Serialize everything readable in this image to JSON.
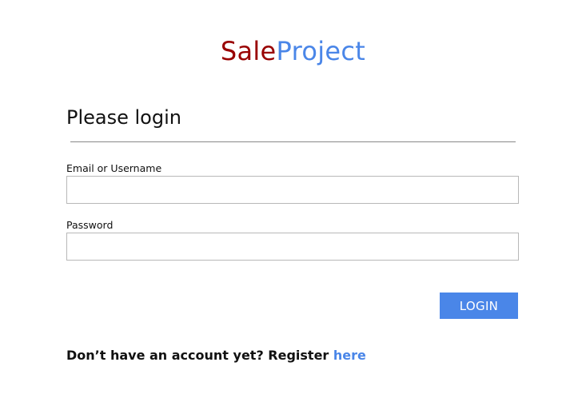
{
  "brand": {
    "part1": "Sale",
    "part2": "Project",
    "part1_color": "#990000",
    "part2_color": "#4a86e8"
  },
  "form": {
    "title": "Please login",
    "email_label": "Email or Username",
    "email_value": "",
    "password_label": "Password",
    "password_value": "",
    "login_button": "LOGIN",
    "button_color": "#4a86e8"
  },
  "footer": {
    "register_text": "Don’t have an account yet? Register ",
    "register_link": "here",
    "link_color": "#4a86e8"
  }
}
